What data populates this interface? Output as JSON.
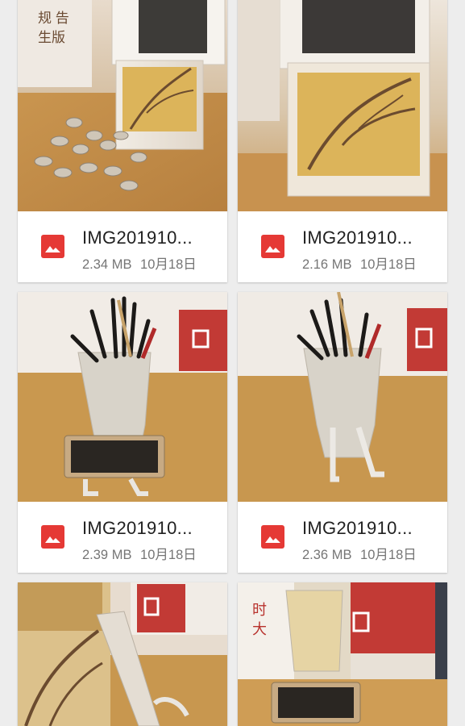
{
  "files": [
    {
      "name": "IMG201910...",
      "size": "2.34 MB",
      "date": "10月18日",
      "icon": "image-file-icon"
    },
    {
      "name": "IMG201910...",
      "size": "2.16 MB",
      "date": "10月18日",
      "icon": "image-file-icon"
    },
    {
      "name": "IMG201910...",
      "size": "2.39 MB",
      "date": "10月18日",
      "icon": "image-file-icon"
    },
    {
      "name": "IMG201910...",
      "size": "2.36 MB",
      "date": "10月18日",
      "icon": "image-file-icon"
    },
    {
      "name": "",
      "size": "",
      "date": "",
      "icon": "image-file-icon"
    },
    {
      "name": "",
      "size": "",
      "date": "",
      "icon": "image-file-icon"
    }
  ],
  "colors": {
    "background": "#ededed",
    "card": "#ffffff",
    "icon_red": "#e53935",
    "name_text": "#212121",
    "meta_text": "#757575"
  }
}
